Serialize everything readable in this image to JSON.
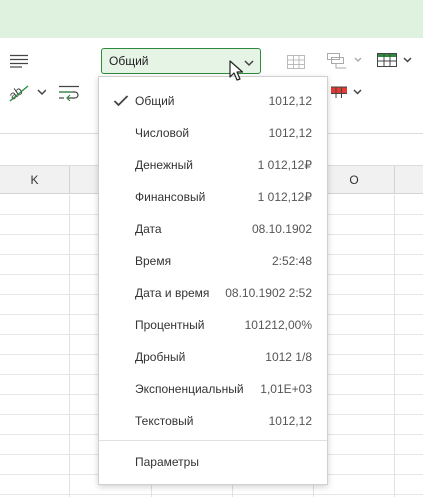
{
  "format_select": {
    "value": "Общий"
  },
  "column_headers": [
    "K",
    "O"
  ],
  "format_options": [
    {
      "label": "Общий",
      "example": "1012,12",
      "checked": true
    },
    {
      "label": "Числовой",
      "example": "1012,12",
      "checked": false
    },
    {
      "label": "Денежный",
      "example": "1 012,12₽",
      "checked": false
    },
    {
      "label": "Финансовый",
      "example": "1 012,12₽",
      "checked": false
    },
    {
      "label": "Дата",
      "example": "08.10.1902",
      "checked": false
    },
    {
      "label": "Время",
      "example": "2:52:48",
      "checked": false
    },
    {
      "label": "Дата и время",
      "example": "08.10.1902 2:52",
      "checked": false
    },
    {
      "label": "Процентный",
      "example": "101212,00%",
      "checked": false
    },
    {
      "label": "Дробный",
      "example": "1012 1/8",
      "checked": false
    },
    {
      "label": "Экспоненциальный",
      "example": "1,01E+03",
      "checked": false
    },
    {
      "label": "Текстовый",
      "example": "1012,12",
      "checked": false
    }
  ],
  "footer_option": {
    "label": "Параметры"
  },
  "colors": {
    "accent": "#2e8b3e",
    "select_bg": "#e6f4e6",
    "top_band": "#dff1df",
    "fill_red": "#e53935"
  }
}
